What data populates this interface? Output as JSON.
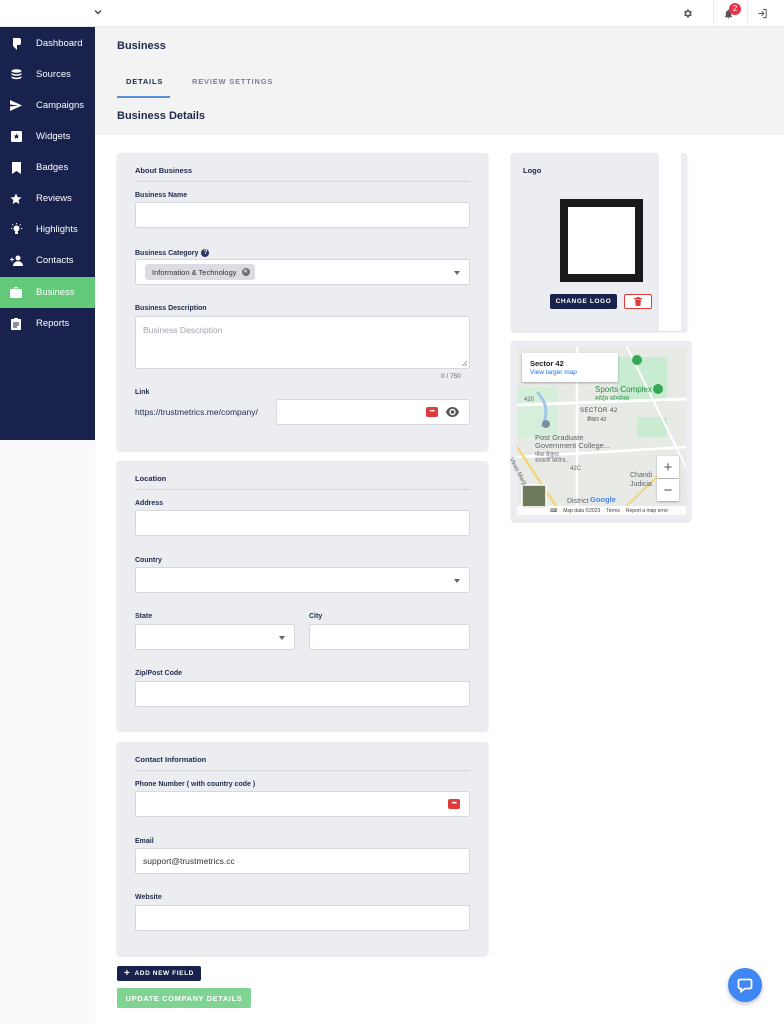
{
  "topbar": {
    "notification_count": "2"
  },
  "sidebar": {
    "items": [
      {
        "label": "Dashboard",
        "icon": "dashboard-icon"
      },
      {
        "label": "Sources",
        "icon": "database-icon"
      },
      {
        "label": "Campaigns",
        "icon": "send-icon"
      },
      {
        "label": "Widgets",
        "icon": "widget-icon"
      },
      {
        "label": "Badges",
        "icon": "bookmark-icon"
      },
      {
        "label": "Reviews",
        "icon": "star-icon"
      },
      {
        "label": "Highlights",
        "icon": "lightbulb-icon"
      },
      {
        "label": "Contacts",
        "icon": "add-person-icon"
      },
      {
        "label": "Business",
        "icon": "briefcase-icon",
        "active": true
      },
      {
        "label": "Reports",
        "icon": "clipboard-icon"
      }
    ]
  },
  "page": {
    "title": "Business",
    "tabs": [
      {
        "label": "DETAILS",
        "active": true
      },
      {
        "label": "REVIEW SETTINGS",
        "active": false
      }
    ],
    "section_title": "Business Details"
  },
  "about": {
    "title": "About Business",
    "name_label": "Business Name",
    "name_value": "",
    "category_label": "Business Category",
    "category_chip": "Information & Technology",
    "description_label": "Business Description",
    "description_placeholder": "Business Description",
    "description_counter": "0 / 750",
    "link_label": "Link",
    "link_prefix": "https://trustmetrics.me/company/",
    "link_value": ""
  },
  "location": {
    "title": "Location",
    "address_label": "Address",
    "country_label": "Country",
    "state_label": "State",
    "city_label": "City",
    "zip_label": "Zip/Post Code"
  },
  "contact": {
    "title": "Contact Information",
    "phone_label": "Phone Number ( with country code )",
    "email_label": "Email",
    "email_value": "support@trustmetrics.cc",
    "website_label": "Website"
  },
  "logo": {
    "title": "Logo",
    "change_label": "CHANGE LOGO"
  },
  "map": {
    "place": "Sector 42",
    "larger_link": "View larger map",
    "labels": {
      "sports": "Sports Complex",
      "sports_hi": "स्पोर्ट्स कॉम्प्लेक्स",
      "sector": "SECTOR 42",
      "sector_hi": "सैक्टर 42",
      "college1": "Post Graduate",
      "college2": "Government College...",
      "college3": "पोस्ट ग्रेजुएट",
      "college4": "सरकारी कॉलेज...",
      "road420": "420",
      "road42c": "42C",
      "vikas": "Vikas Marg",
      "chandi": "Chandi",
      "judicial": "Judicia",
      "district": "District",
      "google": "Google"
    },
    "attribution": {
      "data": "Map data ©2023",
      "terms": "Terms",
      "report": "Report a map error"
    }
  },
  "actions": {
    "add_field": "ADD NEW FIELD",
    "update": "UPDATE COMPANY DETAILS"
  },
  "colors": {
    "sidebar": "#18224d",
    "active": "#64ca79",
    "card": "#ecedf1",
    "danger": "#e13b3b",
    "accent": "#3f87f5"
  }
}
